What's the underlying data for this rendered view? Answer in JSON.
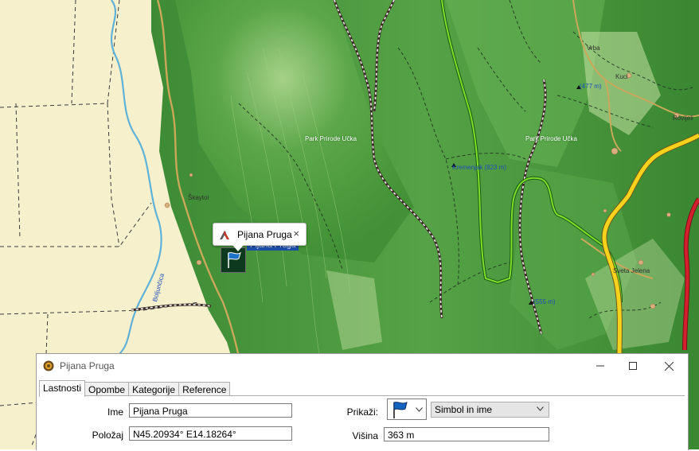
{
  "map": {
    "waypoint_label": "Pijana Pruga",
    "labels": [
      {
        "id": "skaytoi",
        "text": "Škaytoi",
        "cls": ""
      },
      {
        "id": "park1",
        "text": "Park Prirode Učka",
        "cls": "white"
      },
      {
        "id": "park2",
        "text": "Park Prirode Učka",
        "cls": "white"
      },
      {
        "id": "peak1",
        "text": "Kremenjak (823 m)",
        "cls": "blue"
      },
      {
        "id": "peak2",
        "text": "(477 m)",
        "cls": "blue"
      },
      {
        "id": "peak3",
        "text": "(555 m)",
        "cls": "blue"
      },
      {
        "id": "sveta",
        "text": "Sveta Jelena",
        "cls": ""
      },
      {
        "id": "vrba",
        "text": "Vrba",
        "cls": ""
      },
      {
        "id": "kuci",
        "text": "Kuci",
        "cls": ""
      },
      {
        "id": "rovijeli",
        "text": "Rovijeli",
        "cls": ""
      },
      {
        "id": "river",
        "text": "Boljunčica",
        "cls": "blue"
      }
    ]
  },
  "callout": {
    "name": "Pijana Pruga",
    "close": "×"
  },
  "dialog": {
    "title": "Pijana Pruga",
    "tabs": [
      "Lastnosti",
      "Opombe",
      "Kategorije",
      "Reference"
    ],
    "fields": {
      "ime_label": "Ime",
      "ime_value": "Pijana Pruga",
      "polozaj_label": "Položaj",
      "polozaj_value": "N45.20934° E14.18264°",
      "prikazi_label": "Prikaži:",
      "prikazi_value": "Simbol in ime",
      "visina_label": "Višina",
      "visina_value": "363 m"
    },
    "icon": "blue-flag-icon",
    "colors": {
      "map_green": "#4ea13f",
      "map_beige": "#f6f0cd",
      "route_yellow": "#f7d21c",
      "track_green": "#7ddf2c",
      "road_red": "#d4202e",
      "river": "#5fb2d8"
    }
  }
}
